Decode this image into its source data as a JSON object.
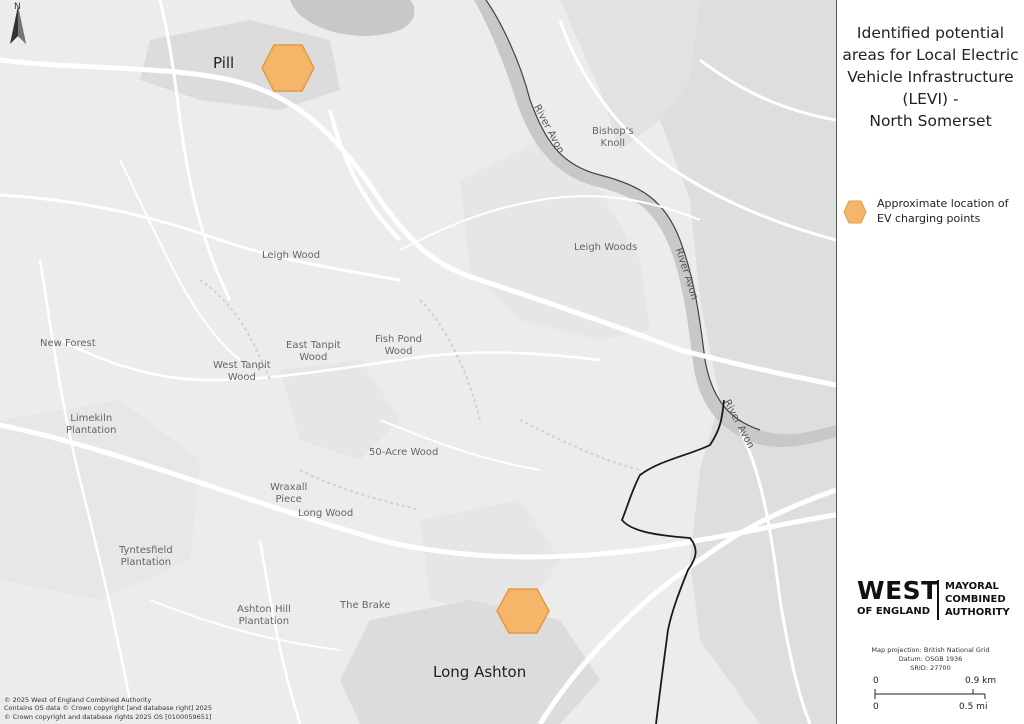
{
  "panel": {
    "title_lines": [
      "Identified potential",
      "areas for Local Electric",
      "Vehicle Infrastructure",
      "(LEVI) -",
      "North Somerset"
    ],
    "legend": {
      "label_lines": [
        "Approximate location of",
        "EV charging points"
      ],
      "swatch_color": "#f5b66a",
      "swatch_icon": "hexagon-marker"
    },
    "logo": {
      "west": "WEST",
      "of_england": "OF ENGLAND",
      "right_lines": [
        "MAYORAL",
        "COMBINED",
        "AUTHORITY"
      ]
    },
    "projection_lines": [
      "Map projection: British National Grid",
      "Datum: OSGB 1936",
      "SRID: 27700"
    ],
    "scale": {
      "km_start": "0",
      "km_end": "0.9 km",
      "mi_start": "0",
      "mi_end": "0.5 mi"
    }
  },
  "map": {
    "north_label": "N",
    "towns": {
      "pill": "Pill",
      "long_ashton": "Long Ashton"
    },
    "places": {
      "leigh_wood": "Leigh Wood",
      "new_forest": "New Forest",
      "west_tanpit_1": "West Tanpit",
      "west_tanpit_2": "Wood",
      "east_tanpit_1": "East Tanpit",
      "east_tanpit_2": "Wood",
      "fish_pond_1": "Fish Pond",
      "fish_pond_2": "Wood",
      "limekiln_1": "Limekiln",
      "limekiln_2": "Plantation",
      "fifty_acre": "50-Acre Wood",
      "wraxall_1": "Wraxall",
      "wraxall_2": "Piece",
      "long_wood": "Long Wood",
      "tyntesfield_1": "Tyntesfield",
      "tyntesfield_2": "Plantation",
      "ashton_hill_1": "Ashton Hill",
      "ashton_hill_2": "Plantation",
      "the_brake": "The Brake",
      "leigh_woods": "Leigh Woods",
      "bishops_knoll_1": "Bishop's",
      "bishops_knoll_2": "Knoll"
    },
    "river_labels": [
      "River Avon",
      "River Avon",
      "River Avon"
    ],
    "markers_color": "#f5b66a",
    "river_color": "#c8c8c8",
    "boundary_color": "#1a1a1a",
    "attribution_lines": [
      "© 2025 West of England Combined Authority",
      "Contains OS data © Crown copyright [and database right] 2025",
      "© Crown copyright and database rights 2025 OS [0100059651]"
    ]
  }
}
